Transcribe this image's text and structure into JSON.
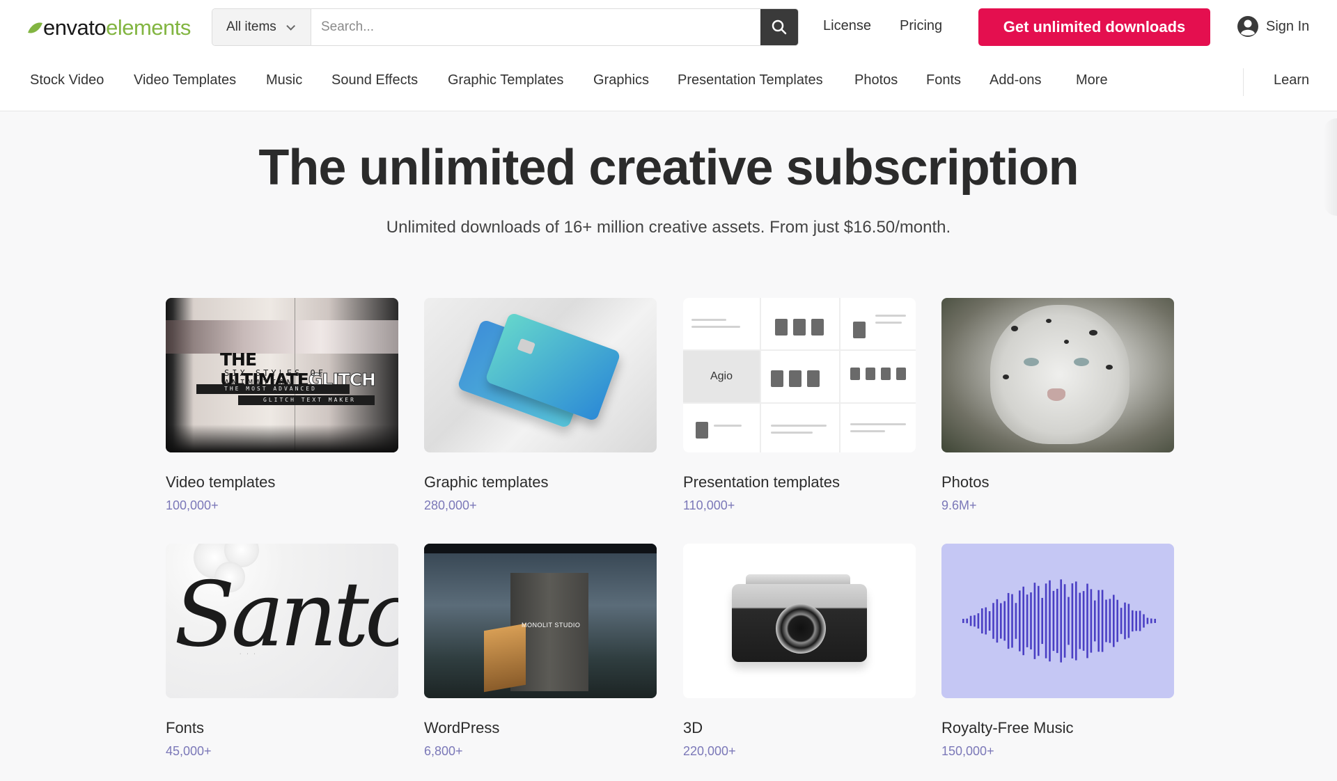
{
  "logo": {
    "part1": "envato",
    "part2": "elements",
    "accent_color": "#82b541"
  },
  "search": {
    "category": "All items",
    "placeholder": "Search...",
    "icon": "search-icon"
  },
  "header_links": {
    "license": "License",
    "pricing": "Pricing"
  },
  "cta": {
    "label": "Get unlimited downloads",
    "color": "#e40f4f"
  },
  "signin": {
    "label": "Sign In",
    "icon": "user-circle-icon"
  },
  "nav": {
    "items": [
      "Stock Video",
      "Video Templates",
      "Music",
      "Sound Effects",
      "Graphic Templates",
      "Graphics",
      "Presentation Templates",
      "Photos",
      "Fonts",
      "Add-ons",
      "More"
    ],
    "learn": "Learn"
  },
  "hero": {
    "title": "The unlimited creative subscription",
    "subtitle": "Unlimited downloads of 16+ million creative assets. From just $16.50/month."
  },
  "categories": [
    {
      "title": "Video templates",
      "count": "100,000+"
    },
    {
      "title": "Graphic templates",
      "count": "280,000+"
    },
    {
      "title": "Presentation templates",
      "count": "110,000+"
    },
    {
      "title": "Photos",
      "count": "9.6M+"
    },
    {
      "title": "Fonts",
      "count": "45,000+"
    },
    {
      "title": "WordPress",
      "count": "6,800+"
    },
    {
      "title": "3D",
      "count": "220,000+"
    },
    {
      "title": "Royalty-Free Music",
      "count": "150,000+"
    }
  ],
  "thumb_text": {
    "video_main": "THE ULTIMATE",
    "video_main2": "GLITCH",
    "video_sub": "SIX STYLES OF ANIMATION",
    "video_line1": "THE MOST ADVANCED",
    "video_line2": "GLITCH TEXT MAKER",
    "pres_brand": "Agio",
    "fonts_script": "Santoy",
    "wp_studio": "MONOLIT STUDIO"
  },
  "count_color": "#7b78b8"
}
